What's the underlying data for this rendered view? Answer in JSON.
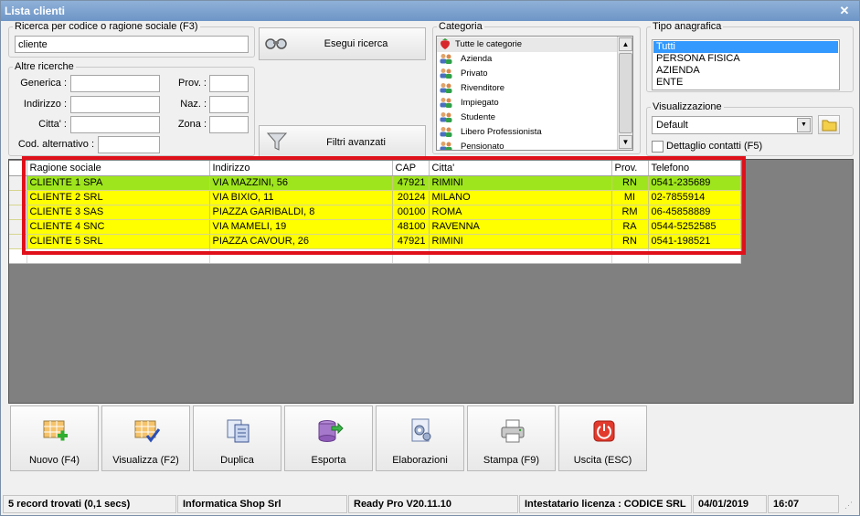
{
  "window": {
    "title": "Lista clienti"
  },
  "search": {
    "legend": "Ricerca per codice o ragione sociale (F3)",
    "value": "cliente",
    "button_label": "Esegui ricerca"
  },
  "other_search": {
    "legend": "Altre ricerche",
    "generica_label": "Generica :",
    "indirizzo_label": "Indirizzo :",
    "citta_label": "Citta' :",
    "cod_alt_label": "Cod. alternativo :",
    "prov_label": "Prov. :",
    "naz_label": "Naz. :",
    "zona_label": "Zona :"
  },
  "filters_button": "Filtri avanzati",
  "categoria": {
    "legend": "Categoria",
    "items": [
      {
        "label": "Tutte le categorie",
        "icon": "strawberry-icon"
      },
      {
        "label": "Azienda",
        "icon": "users-icon"
      },
      {
        "label": "Privato",
        "icon": "users-icon"
      },
      {
        "label": "Rivenditore",
        "icon": "users-icon"
      },
      {
        "label": "Impiegato",
        "icon": "users-icon"
      },
      {
        "label": "Studente",
        "icon": "users-icon"
      },
      {
        "label": "Libero Professionista",
        "icon": "users-icon"
      },
      {
        "label": "Pensionato",
        "icon": "users-icon"
      }
    ]
  },
  "tipo": {
    "legend": "Tipo anagrafica",
    "items": [
      "Tutti",
      "PERSONA FISICA",
      "AZIENDA",
      "ENTE"
    ],
    "selected": "Tutti"
  },
  "visualizzazione": {
    "legend": "Visualizzazione",
    "value": "Default",
    "dettaglio_label": "Dettaglio contatti (F5)"
  },
  "grid": {
    "columns": [
      "Ragione sociale",
      "Indirizzo",
      "CAP",
      "Citta'",
      "Prov.",
      "Telefono"
    ],
    "rows": [
      [
        "CLIENTE 1 SPA",
        "VIA MAZZINI, 56",
        "47921",
        "RIMINI",
        "RN",
        "0541-235689"
      ],
      [
        "CLIENTE 2 SRL",
        "VIA BIXIO, 11",
        "20124",
        "MILANO",
        "MI",
        "02-7855914"
      ],
      [
        "CLIENTE 3 SAS",
        "PIAZZA GARIBALDI, 8",
        "00100",
        "ROMA",
        "RM",
        "06-45858889"
      ],
      [
        "CLIENTE 4 SNC",
        "VIA MAMELI, 19",
        "48100",
        "RAVENNA",
        "RA",
        "0544-5252585"
      ],
      [
        "CLIENTE 5 SRL",
        "PIAZZA CAVOUR, 26",
        "47921",
        "RIMINI",
        "RN",
        "0541-198521"
      ]
    ],
    "selected_row_color": "#9fe51d",
    "row_color": "#ffff00"
  },
  "toolbar": {
    "nuovo": "Nuovo (F4)",
    "visualizza": "Visualizza (F2)",
    "duplica": "Duplica",
    "esporta": "Esporta",
    "elaborazioni": "Elaborazioni",
    "stampa": "Stampa (F9)",
    "uscita": "Uscita (ESC)"
  },
  "status": {
    "records": "5 record trovati (0,1 secs)",
    "company": "Informatica Shop Srl",
    "version": "Ready Pro V20.11.10",
    "license": "Intestatario licenza : CODICE SRL",
    "date": "04/01/2019",
    "time": "16:07"
  }
}
